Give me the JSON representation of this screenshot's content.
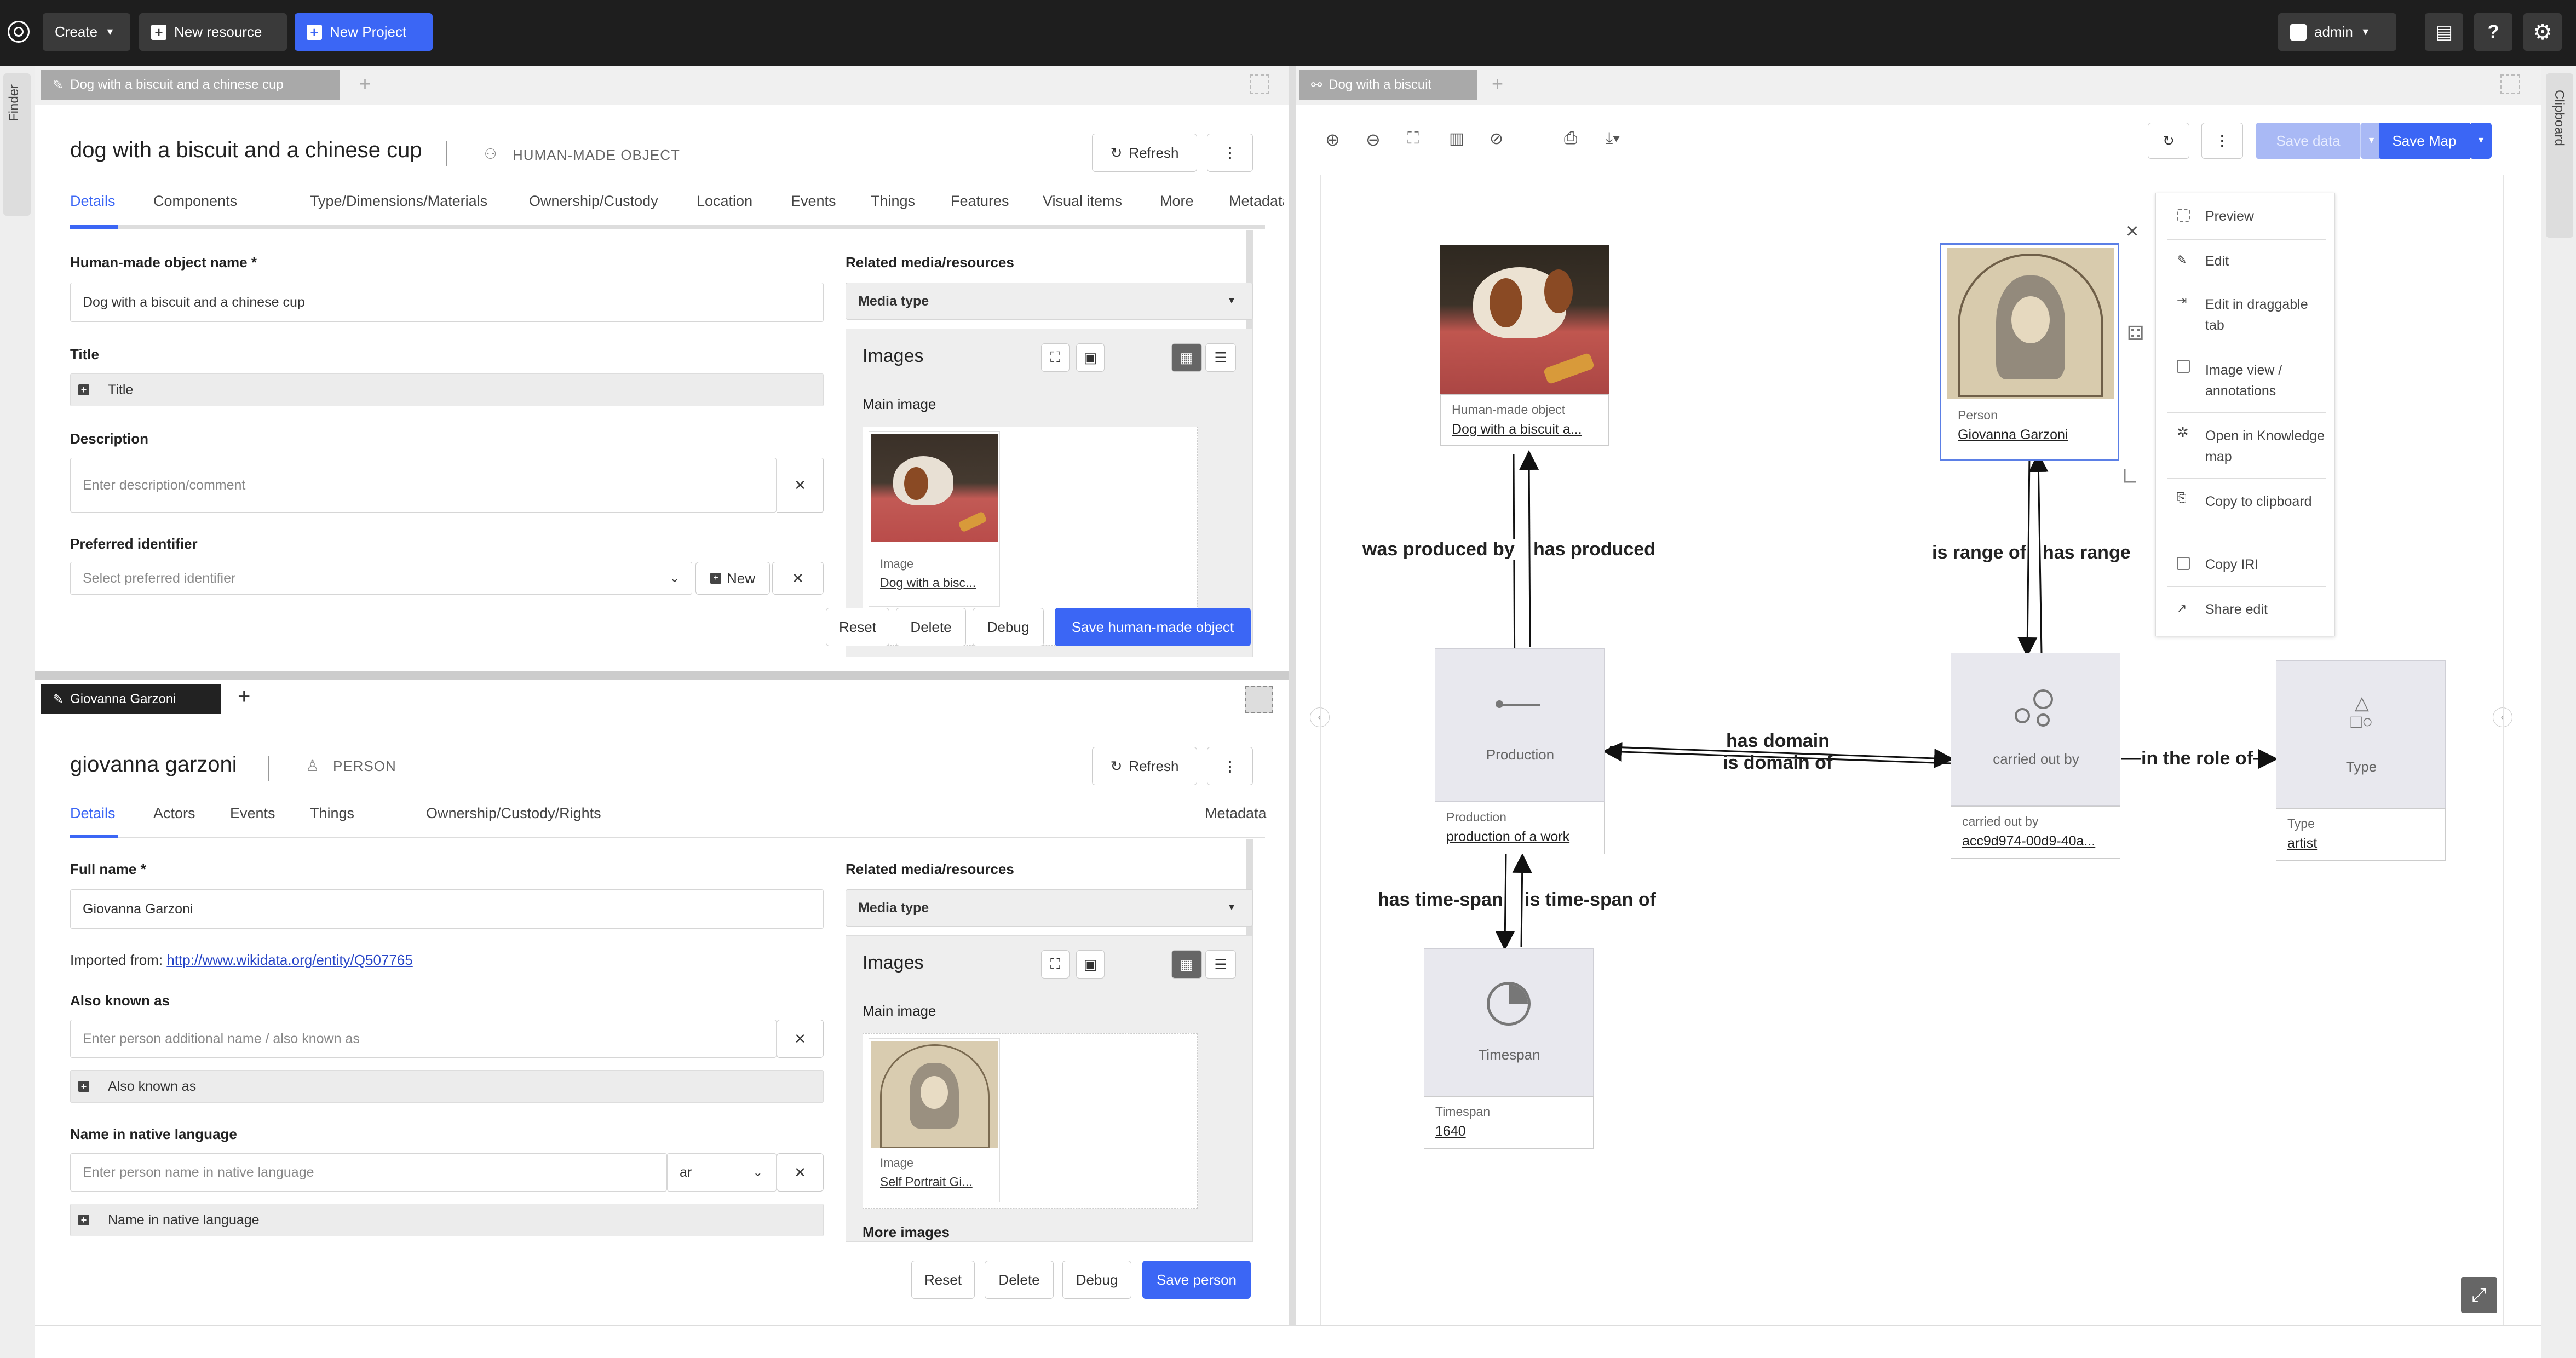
{
  "topbar": {
    "create": "Create",
    "new_resource": "New resource",
    "new_project": "New Project",
    "user": "admin"
  },
  "sidebar": {
    "left": "Finder",
    "right": "Clipboard"
  },
  "panel1": {
    "tab": "Dog with a biscuit and a chinese cup",
    "title": "dog with a biscuit and a chinese cup",
    "type": "HUMAN-MADE OBJECT",
    "refresh": "Refresh",
    "tabs": [
      "Details",
      "Components",
      "Type/Dimensions/Materials",
      "Ownership/Custody",
      "Location",
      "Events",
      "Things",
      "Features",
      "Visual items",
      "More",
      "Metadata"
    ],
    "name_label": "Human-made object name *",
    "name_value": "Dog with a biscuit and a chinese cup",
    "title_label": "Title",
    "title_add": "Title",
    "desc_label": "Description",
    "desc_ph": "Enter description/comment",
    "pid_label": "Preferred identifier",
    "pid_ph": "Select preferred identifier",
    "pid_new": "New",
    "media_label": "Related media/resources",
    "media_type": "Media type",
    "images": "Images",
    "main_image": "Main image",
    "img_type": "Image",
    "img_name": "Dog with a bisc...",
    "reset": "Reset",
    "delete": "Delete",
    "debug": "Debug",
    "save": "Save human-made object"
  },
  "panel2": {
    "tab": "Giovanna Garzoni",
    "title": "giovanna garzoni",
    "type": "PERSON",
    "refresh": "Refresh",
    "tabs": [
      "Details",
      "Actors",
      "Events",
      "Things",
      "Ownership/Custody/Rights"
    ],
    "metadata": "Metadata",
    "full_label": "Full name *",
    "full_value": "Giovanna Garzoni",
    "imported": "Imported from:",
    "imported_link": "http://www.wikidata.org/entity/Q507765",
    "aka_label": "Also known as",
    "aka_ph": "Enter person additional name / also known as",
    "aka_add": "Also known as",
    "native_label": "Name in native language",
    "native_ph": "Enter person name in native language",
    "native_lang": "ar",
    "native_add": "Name in native language",
    "media_label": "Related media/resources",
    "media_type": "Media type",
    "images": "Images",
    "main_image": "Main image",
    "img_type": "Image",
    "img_name": "Self Portrait Gi...",
    "more_images": "More images",
    "reset": "Reset",
    "delete": "Delete",
    "debug": "Debug",
    "save": "Save person"
  },
  "map": {
    "tab": "Dog with a biscuit",
    "save_data": "Save data",
    "save_map": "Save Map",
    "nodes": {
      "hmo_type": "Human-made object",
      "hmo_name": "Dog with a biscuit a...",
      "person_type": "Person",
      "person_name": "Giovanna Garzoni",
      "prod_center": "Production",
      "prod_type": "Production",
      "prod_name": "production of a work",
      "carried_center": "carried out by",
      "carried_type": "carried out by",
      "carried_name": "acc9d974-00d9-40a...",
      "type_center": "Type",
      "type_type": "Type",
      "type_name": "artist",
      "ts_center": "Timespan",
      "ts_type": "Timespan",
      "ts_name": "1640"
    },
    "edges": {
      "produced_by": "was produced by",
      "has_produced": "has produced",
      "range_of": "is range of",
      "has_range": "has range",
      "has_domain": "has domain",
      "domain_of": "is domain of",
      "in_role": "in the role of",
      "has_ts": "has time-span",
      "ts_of": "is time-span of"
    },
    "menu": [
      "Preview",
      "Edit",
      "Edit in draggable tab",
      "Image view / annotations",
      "Open in Knowledge map",
      "Copy to clipboard",
      "Copy IRI",
      "Share edit"
    ]
  }
}
